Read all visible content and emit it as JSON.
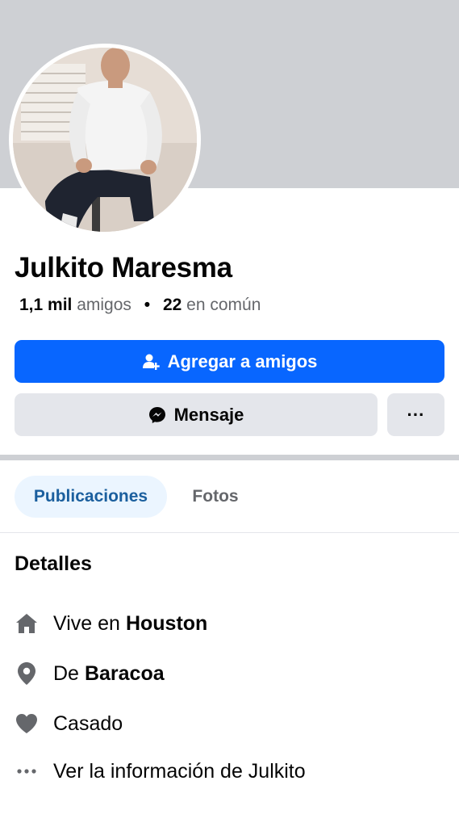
{
  "profile": {
    "name": "Julkito Maresma",
    "friends_count": "1,1 mil",
    "friends_label": "amigos",
    "separator": "•",
    "mutual_count": "22",
    "mutual_label": "en común"
  },
  "actions": {
    "add_friend": "Agregar a amigos",
    "message": "Mensaje",
    "more": "···"
  },
  "tabs": [
    {
      "label": "Publicaciones",
      "active": true
    },
    {
      "label": "Fotos",
      "active": false
    }
  ],
  "details": {
    "title": "Detalles",
    "lives_in_prefix": "Vive en",
    "lives_in_place": "Houston",
    "from_prefix": "De",
    "from_place": "Baracoa",
    "relationship": "Casado",
    "see_more": "Ver la información de Julkito"
  },
  "icons": {
    "add_friend": "person-plus-icon",
    "message": "messenger-icon",
    "home": "home-icon",
    "location": "location-pin-icon",
    "relationship": "heart-icon",
    "more": "ellipsis-icon"
  },
  "colors": {
    "primary": "#0866ff",
    "cover": "#ced0d4",
    "secondary_button": "#e4e6eb",
    "active_tab_bg": "#ebf5ff",
    "active_tab_text": "#1b5f9e",
    "muted_text": "#65676b",
    "icon_gray": "#65676b"
  }
}
